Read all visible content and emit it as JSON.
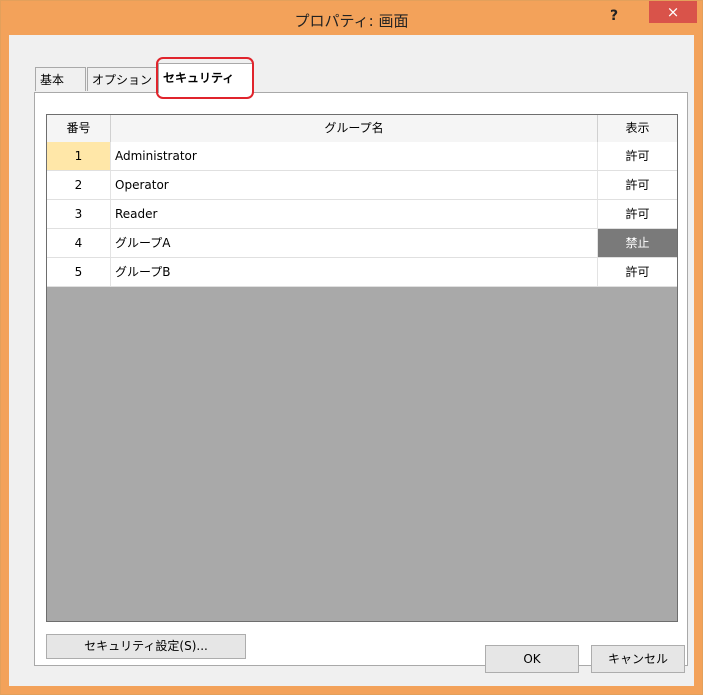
{
  "window": {
    "title": "プロパティ: 画面",
    "help_label": "?",
    "close_label": "×"
  },
  "tabs": [
    {
      "label": "基本"
    },
    {
      "label": "オプション"
    },
    {
      "label": "セキュリティ",
      "selected": true
    }
  ],
  "grid": {
    "headers": {
      "number": "番号",
      "group_name": "グループ名",
      "display": "表示"
    },
    "rows": [
      {
        "number": "1",
        "group_name": "Administrator",
        "display": "許可",
        "selected": true
      },
      {
        "number": "2",
        "group_name": "Operator",
        "display": "許可"
      },
      {
        "number": "3",
        "group_name": "Reader",
        "display": "許可"
      },
      {
        "number": "4",
        "group_name": "グループA",
        "display": "禁止"
      },
      {
        "number": "5",
        "group_name": "グループB",
        "display": "許可"
      }
    ]
  },
  "buttons": {
    "security_settings": "セキュリティ設定(S)...",
    "ok": "OK",
    "cancel": "キャンセル"
  },
  "colors": {
    "titlebar": "#f3a25a",
    "close_button": "#d9534a",
    "tab_highlight": "#e0242c",
    "selected_row_number": "#ffe7a8",
    "denied_cell": "#7a7a7a"
  }
}
